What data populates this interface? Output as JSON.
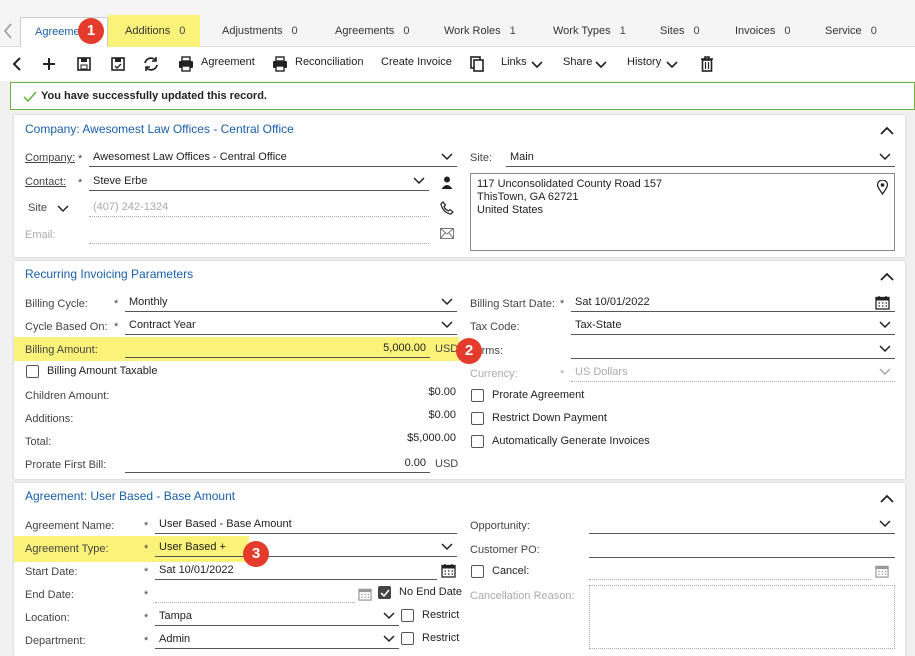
{
  "tabs": [
    {
      "label": "Agreement",
      "count": ""
    },
    {
      "label": "Additions",
      "count": "0"
    },
    {
      "label": "Adjustments",
      "count": "0"
    },
    {
      "label": "Agreements",
      "count": "0"
    },
    {
      "label": "Work Roles",
      "count": "1"
    },
    {
      "label": "Work Types",
      "count": "1"
    },
    {
      "label": "Sites",
      "count": "0"
    },
    {
      "label": "Invoices",
      "count": "0"
    },
    {
      "label": "Service",
      "count": "0"
    }
  ],
  "toolbar": {
    "agreement": "Agreement",
    "reconciliation": "Reconciliation",
    "create_invoice": "Create Invoice",
    "links": "Links",
    "share": "Share",
    "history": "History"
  },
  "success_message": "You have successfully updated this record.",
  "badges": [
    "1",
    "2",
    "3"
  ],
  "company_panel": {
    "title": "Company: Awesomest Law Offices - Central Office",
    "company_label": "Company:",
    "company_value": "Awesomest Law Offices - Central Office",
    "contact_label": "Contact:",
    "contact_value": "Steve Erbe",
    "phone_type": "Site",
    "phone_value": "(407) 242-1324",
    "email_label": "Email:",
    "site_label": "Site:",
    "site_value": "Main",
    "address": [
      "117 Unconsolidated County Road 157",
      "ThisTown, GA 62721",
      "United States"
    ]
  },
  "invoicing_panel": {
    "title": "Recurring Invoicing Parameters",
    "billing_cycle_label": "Billing Cycle:",
    "billing_cycle_value": "Monthly",
    "cycle_based_label": "Cycle Based On:",
    "cycle_based_value": "Contract Year",
    "billing_amount_label": "Billing Amount:",
    "billing_amount_value": "5,000.00",
    "currency_unit": "USD",
    "billing_taxable_label": "Billing Amount Taxable",
    "children_amount_label": "Children Amount:",
    "children_amount_value": "$0.00",
    "additions_label": "Additions:",
    "additions_value": "$0.00",
    "total_label": "Total:",
    "total_value": "$5,000.00",
    "prorate_first_label": "Prorate First Bill:",
    "prorate_first_value": "0.00",
    "billing_start_label": "Billing Start Date:",
    "billing_start_value": "Sat 10/01/2022",
    "tax_code_label": "Tax Code:",
    "tax_code_value": "Tax-State",
    "terms_label": "Terms:",
    "currency_label": "Currency:",
    "currency_value": "US Dollars",
    "prorate_agreement_label": "Prorate Agreement",
    "restrict_down_label": "Restrict Down Payment",
    "auto_generate_label": "Automatically Generate Invoices"
  },
  "agreement_panel": {
    "title": "Agreement: User Based - Base Amount",
    "name_label": "Agreement Name:",
    "name_value": "User Based - Base Amount",
    "type_label": "Agreement Type:",
    "type_value": "User Based +",
    "start_label": "Start Date:",
    "start_value": "Sat 10/01/2022",
    "end_label": "End Date:",
    "no_end_label": "No End Date",
    "location_label": "Location:",
    "location_value": "Tampa",
    "department_label": "Department:",
    "department_value": "Admin",
    "restrict_label": "Restrict",
    "opportunity_label": "Opportunity:",
    "customer_po_label": "Customer PO:",
    "cancel_label": "Cancel:",
    "cancellation_reason_label": "Cancellation Reason:"
  }
}
